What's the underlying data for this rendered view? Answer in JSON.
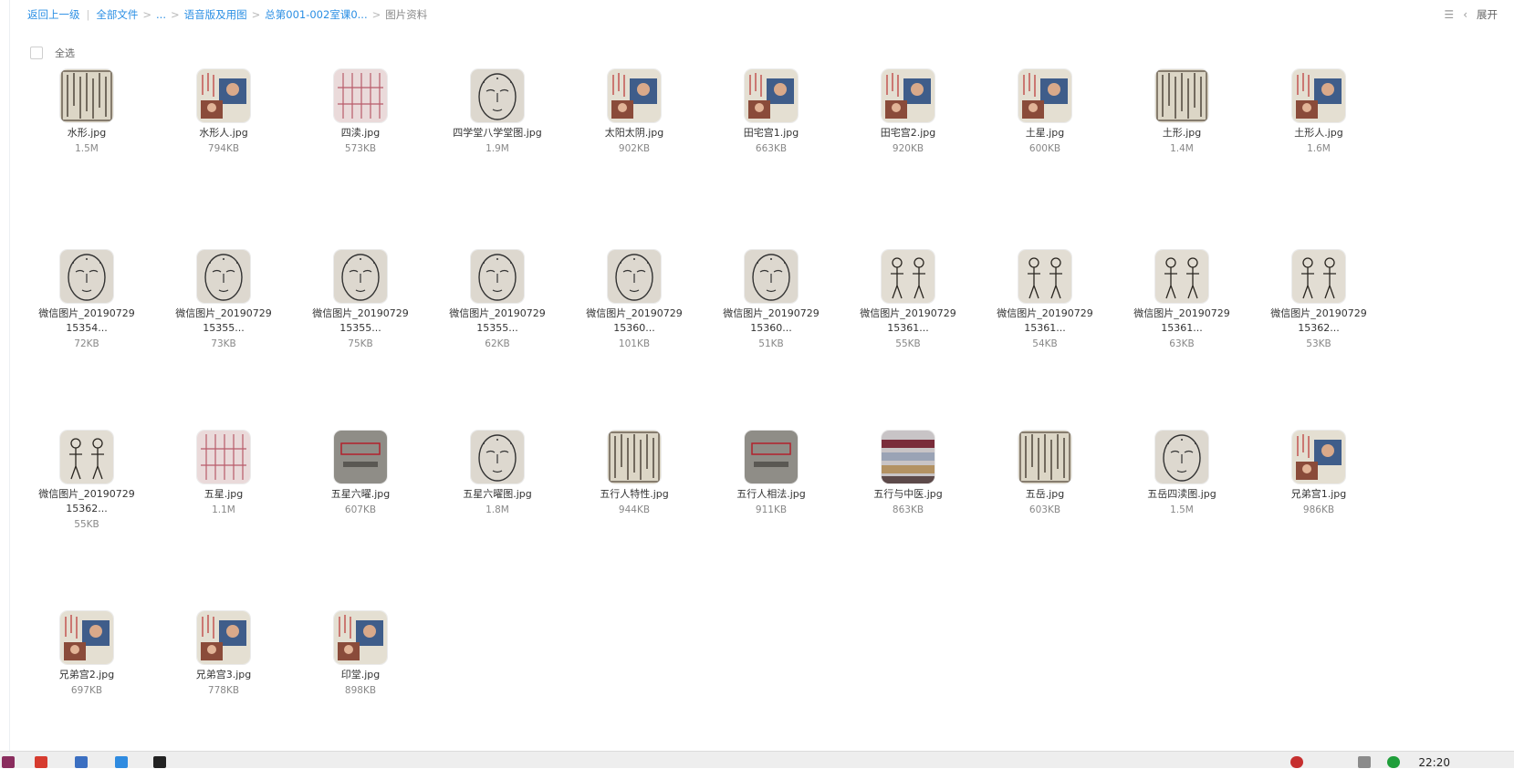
{
  "breadcrumb": {
    "back": "返回上一级",
    "all_files": "全部文件",
    "ellipsis": "...",
    "folder1": "语音版及用图",
    "folder2": "总第001-002室课0...",
    "current": "图片资料"
  },
  "top_right": {
    "expand_label": "展开"
  },
  "select_all": {
    "label": "全选"
  },
  "files": [
    {
      "name": "水形.jpg",
      "size": "1.5M",
      "thumb": "doc"
    },
    {
      "name": "水形人.jpg",
      "size": "794KB",
      "thumb": "photo"
    },
    {
      "name": "四渎.jpg",
      "size": "573KB",
      "thumb": "pink"
    },
    {
      "name": "四学堂八学堂图.jpg",
      "size": "1.9M",
      "thumb": "face"
    },
    {
      "name": "太阳太阴.jpg",
      "size": "902KB",
      "thumb": "photo"
    },
    {
      "name": "田宅宫1.jpg",
      "size": "663KB",
      "thumb": "photo"
    },
    {
      "name": "田宅宫2.jpg",
      "size": "920KB",
      "thumb": "photo"
    },
    {
      "name": "土星.jpg",
      "size": "600KB",
      "thumb": "photo"
    },
    {
      "name": "土形.jpg",
      "size": "1.4M",
      "thumb": "doc"
    },
    {
      "name": "土形人.jpg",
      "size": "1.6M",
      "thumb": "photo"
    },
    {
      "name": "微信图片_2019072915354...",
      "size": "72KB",
      "thumb": "face"
    },
    {
      "name": "微信图片_2019072915355...",
      "size": "73KB",
      "thumb": "face"
    },
    {
      "name": "微信图片_2019072915355...",
      "size": "75KB",
      "thumb": "face"
    },
    {
      "name": "微信图片_2019072915355...",
      "size": "62KB",
      "thumb": "face"
    },
    {
      "name": "微信图片_2019072915360...",
      "size": "101KB",
      "thumb": "face"
    },
    {
      "name": "微信图片_2019072915360...",
      "size": "51KB",
      "thumb": "face"
    },
    {
      "name": "微信图片_2019072915361...",
      "size": "55KB",
      "thumb": "figures"
    },
    {
      "name": "微信图片_2019072915361...",
      "size": "54KB",
      "thumb": "figures"
    },
    {
      "name": "微信图片_2019072915361...",
      "size": "63KB",
      "thumb": "figures"
    },
    {
      "name": "微信图片_2019072915362...",
      "size": "53KB",
      "thumb": "figures"
    },
    {
      "name": "微信图片_2019072915362...",
      "size": "55KB",
      "thumb": "figures"
    },
    {
      "name": "五星.jpg",
      "size": "1.1M",
      "thumb": "pink"
    },
    {
      "name": "五星六曜.jpg",
      "size": "607KB",
      "thumb": "title"
    },
    {
      "name": "五星六曜图.jpg",
      "size": "1.8M",
      "thumb": "face"
    },
    {
      "name": "五行人特性.jpg",
      "size": "944KB",
      "thumb": "doc"
    },
    {
      "name": "五行人相法.jpg",
      "size": "911KB",
      "thumb": "title"
    },
    {
      "name": "五行与中医.jpg",
      "size": "863KB",
      "thumb": "table"
    },
    {
      "name": "五岳.jpg",
      "size": "603KB",
      "thumb": "doc"
    },
    {
      "name": "五岳四渎图.jpg",
      "size": "1.5M",
      "thumb": "face"
    },
    {
      "name": "兄弟宫1.jpg",
      "size": "986KB",
      "thumb": "photo"
    },
    {
      "name": "兄弟宫2.jpg",
      "size": "697KB",
      "thumb": "photo"
    },
    {
      "name": "兄弟宫3.jpg",
      "size": "778KB",
      "thumb": "photo"
    },
    {
      "name": "印堂.jpg",
      "size": "898KB",
      "thumb": "photo"
    }
  ],
  "taskbar": {
    "clock": "22:20"
  }
}
